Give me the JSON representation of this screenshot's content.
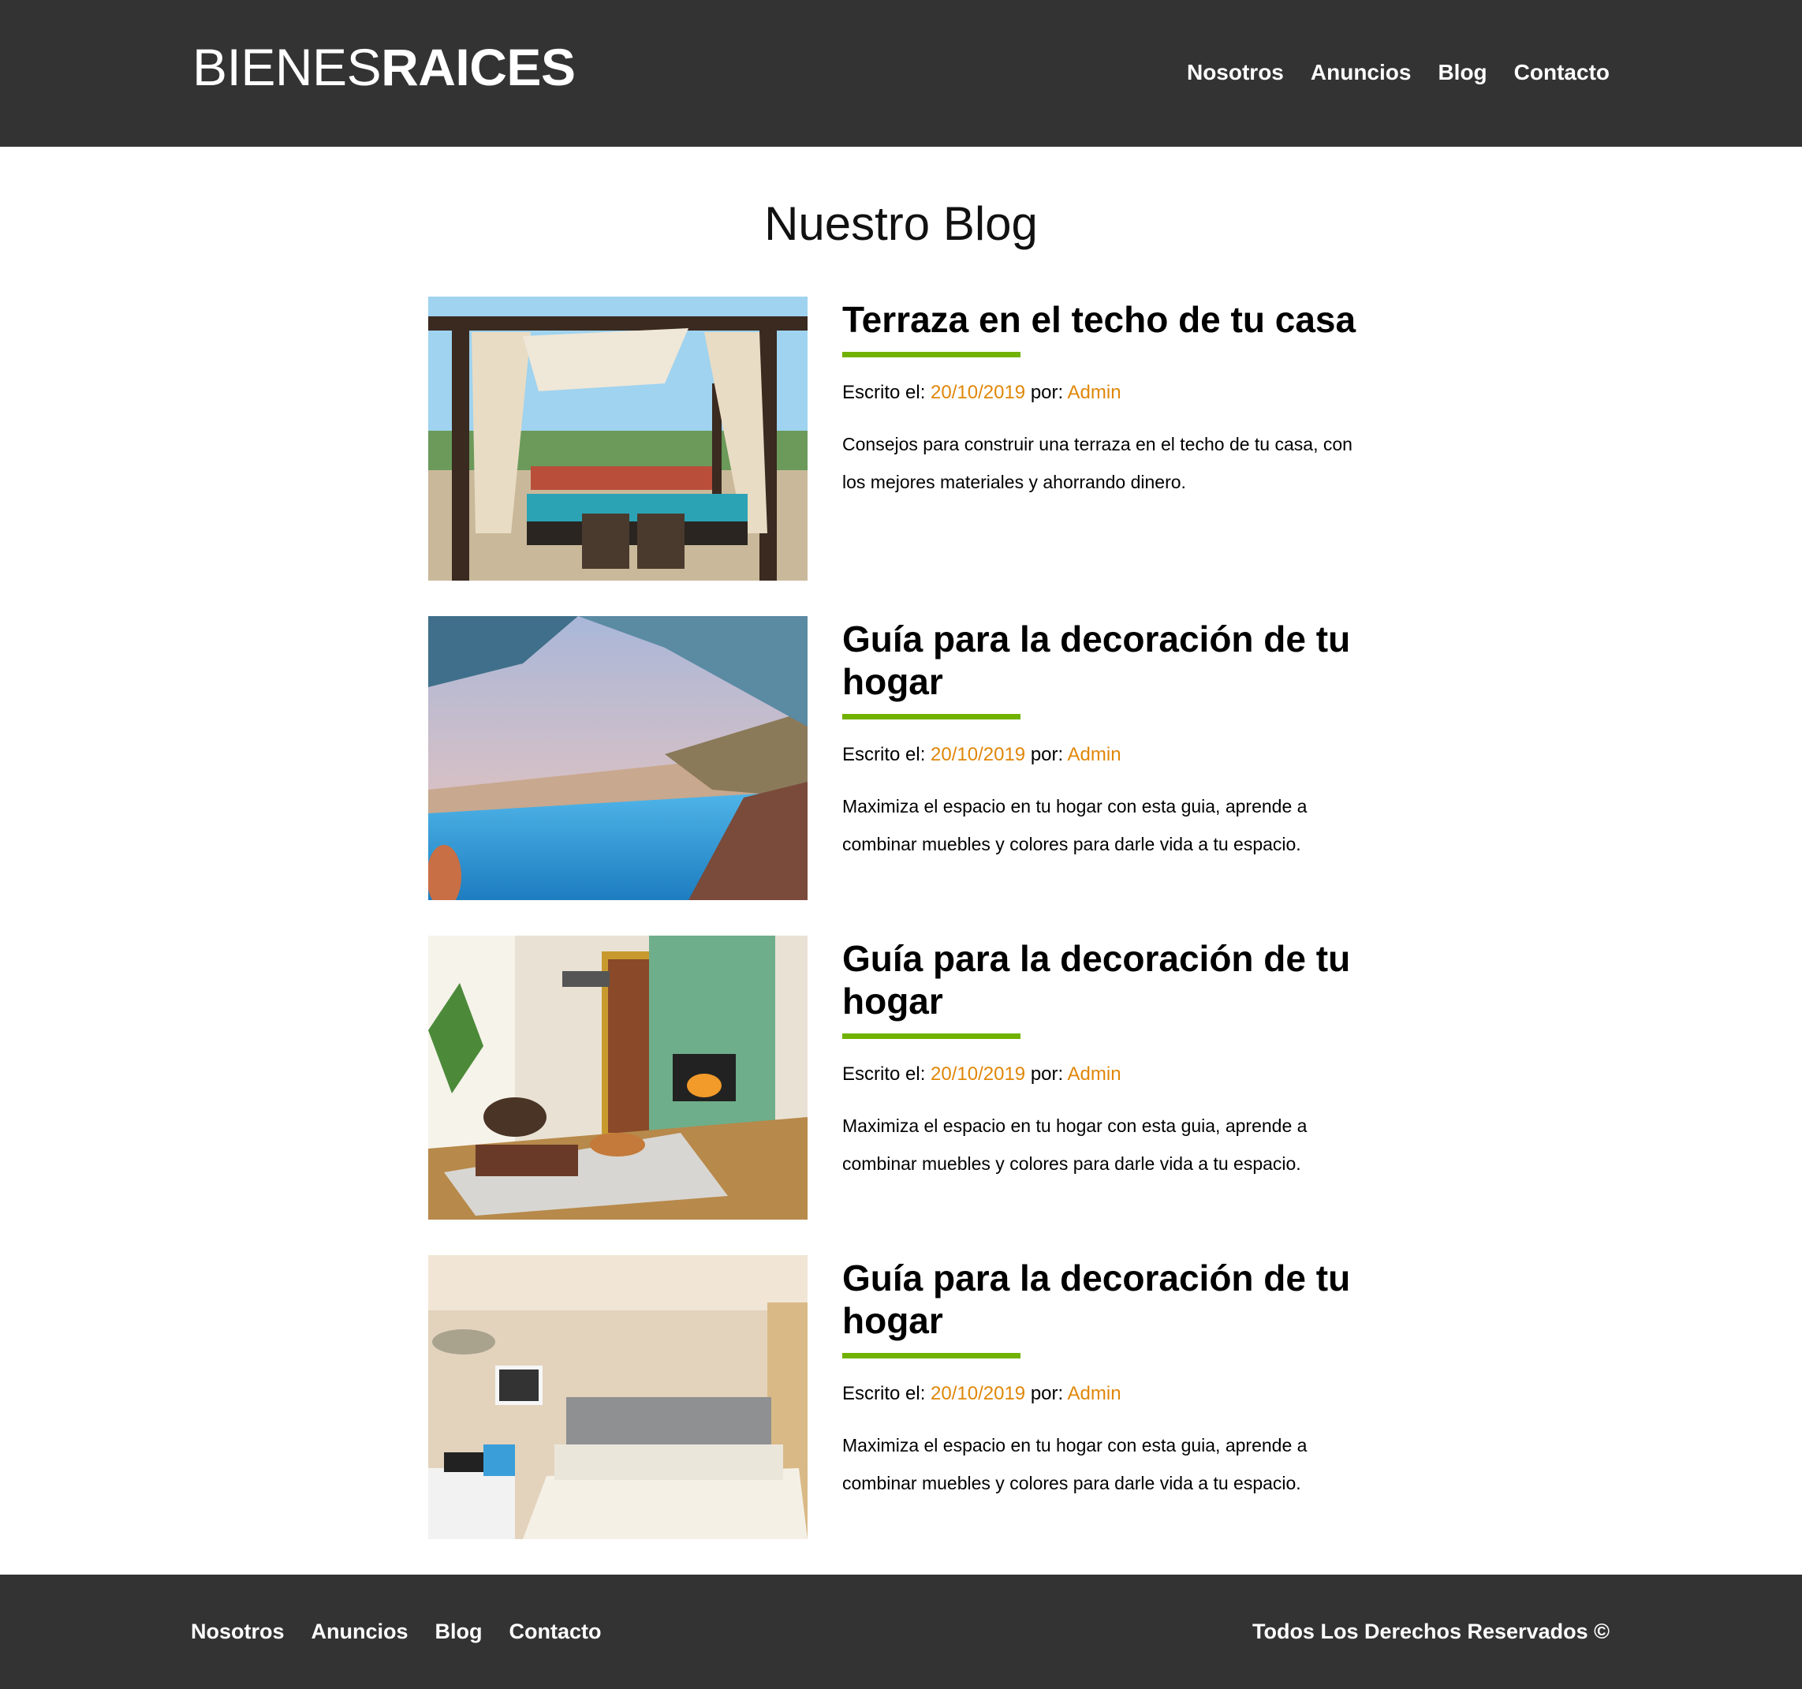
{
  "header": {
    "logo_light": "BIENES",
    "logo_bold": "RAICES",
    "nav": [
      "Nosotros",
      "Anuncios",
      "Blog",
      "Contacto"
    ]
  },
  "page_title": "Nuestro Blog",
  "entries": [
    {
      "title": "Terraza en el techo de tu casa",
      "meta_prefix": "Escrito el: ",
      "date": "20/10/2019",
      "meta_by": " por: ",
      "author": "Admin",
      "excerpt": "Consejos para construir una terraza en el techo de tu casa, con los mejores materiales y ahorrando dinero.",
      "image": "rooftop-terrace-photo"
    },
    {
      "title": "Guía para la decoración de tu hogar",
      "meta_prefix": "Escrito el: ",
      "date": "20/10/2019",
      "meta_by": " por: ",
      "author": "Admin",
      "excerpt": "Maximiza el espacio en tu hogar con esta guia, aprende a combinar muebles y colores para darle vida a tu espacio.",
      "image": "infinity-pool-photo"
    },
    {
      "title": "Guía para la decoración de tu hogar",
      "meta_prefix": "Escrito el: ",
      "date": "20/10/2019",
      "meta_by": " por: ",
      "author": "Admin",
      "excerpt": "Maximiza el espacio en tu hogar con esta guia, aprende a combinar muebles y colores para darle vida a tu espacio.",
      "image": "living-room-photo"
    },
    {
      "title": "Guía para la decoración de tu hogar",
      "meta_prefix": "Escrito el: ",
      "date": "20/10/2019",
      "meta_by": " por: ",
      "author": "Admin",
      "excerpt": "Maximiza el espacio en tu hogar con esta guia, aprende a combinar muebles y colores para darle vida a tu espacio.",
      "image": "bedroom-photo"
    }
  ],
  "footer": {
    "nav": [
      "Nosotros",
      "Anuncios",
      "Blog",
      "Contacto"
    ],
    "copyright": "Todos Los Derechos Reservados ©"
  },
  "colors": {
    "header_bg": "#333333",
    "accent_green": "#71B100",
    "accent_orange": "#E08709"
  }
}
